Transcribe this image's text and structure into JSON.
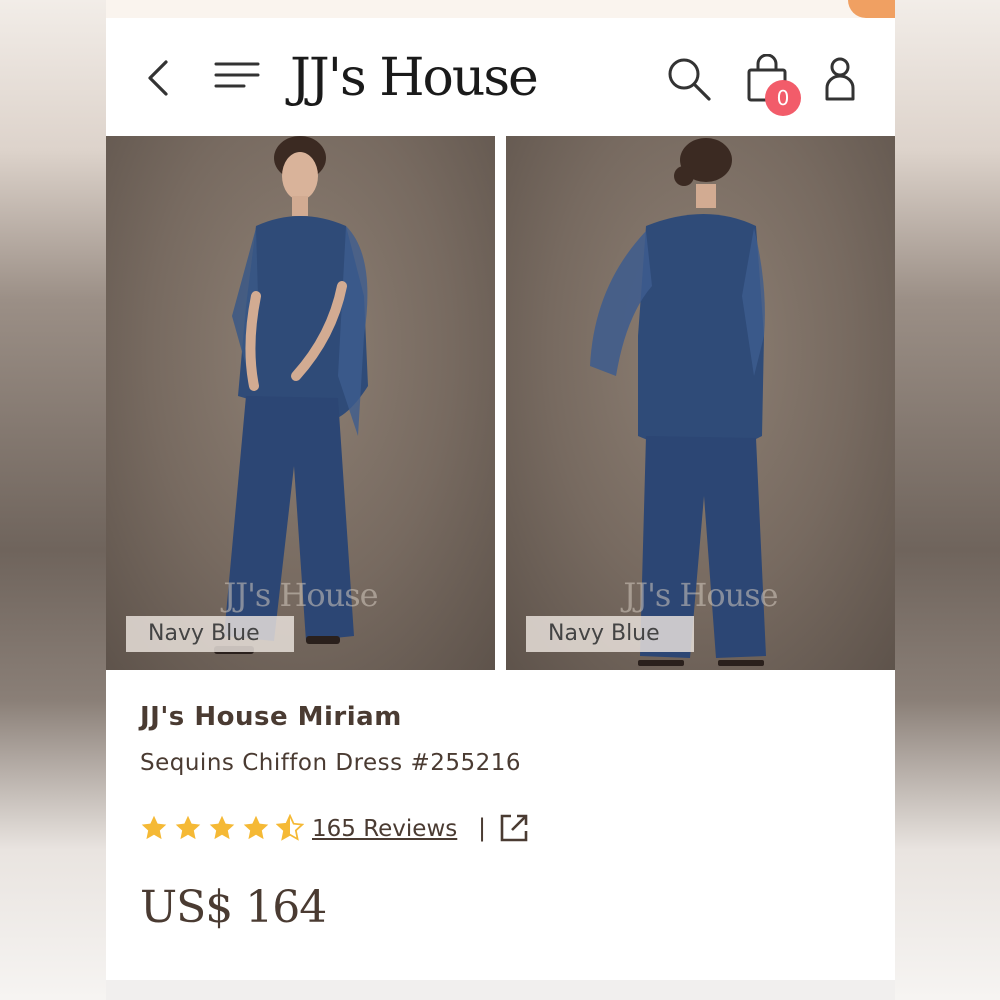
{
  "header": {
    "logo": "JJ's House",
    "cart_count": "0",
    "icons": [
      "back-icon",
      "menu-icon",
      "search-icon",
      "shopping-bag-icon",
      "user-icon"
    ]
  },
  "gallery": {
    "photos": [
      {
        "watermark": "JJ's House",
        "color_tag": "Navy Blue"
      },
      {
        "watermark": "JJ's House",
        "color_tag": "Navy Blue"
      }
    ]
  },
  "product": {
    "title": "JJ's House Miriam",
    "subtitle": "Sequins Chiffon Dress #255216",
    "rating": 4.5,
    "rating_max": 5,
    "reviews_label": "165 Reviews",
    "divider": "|",
    "price": "US$ 164"
  },
  "colors": {
    "accent_badge": "#f25c6a",
    "star": "#f5b935",
    "text": "#4a3b32",
    "dress": "#2f4b78"
  }
}
